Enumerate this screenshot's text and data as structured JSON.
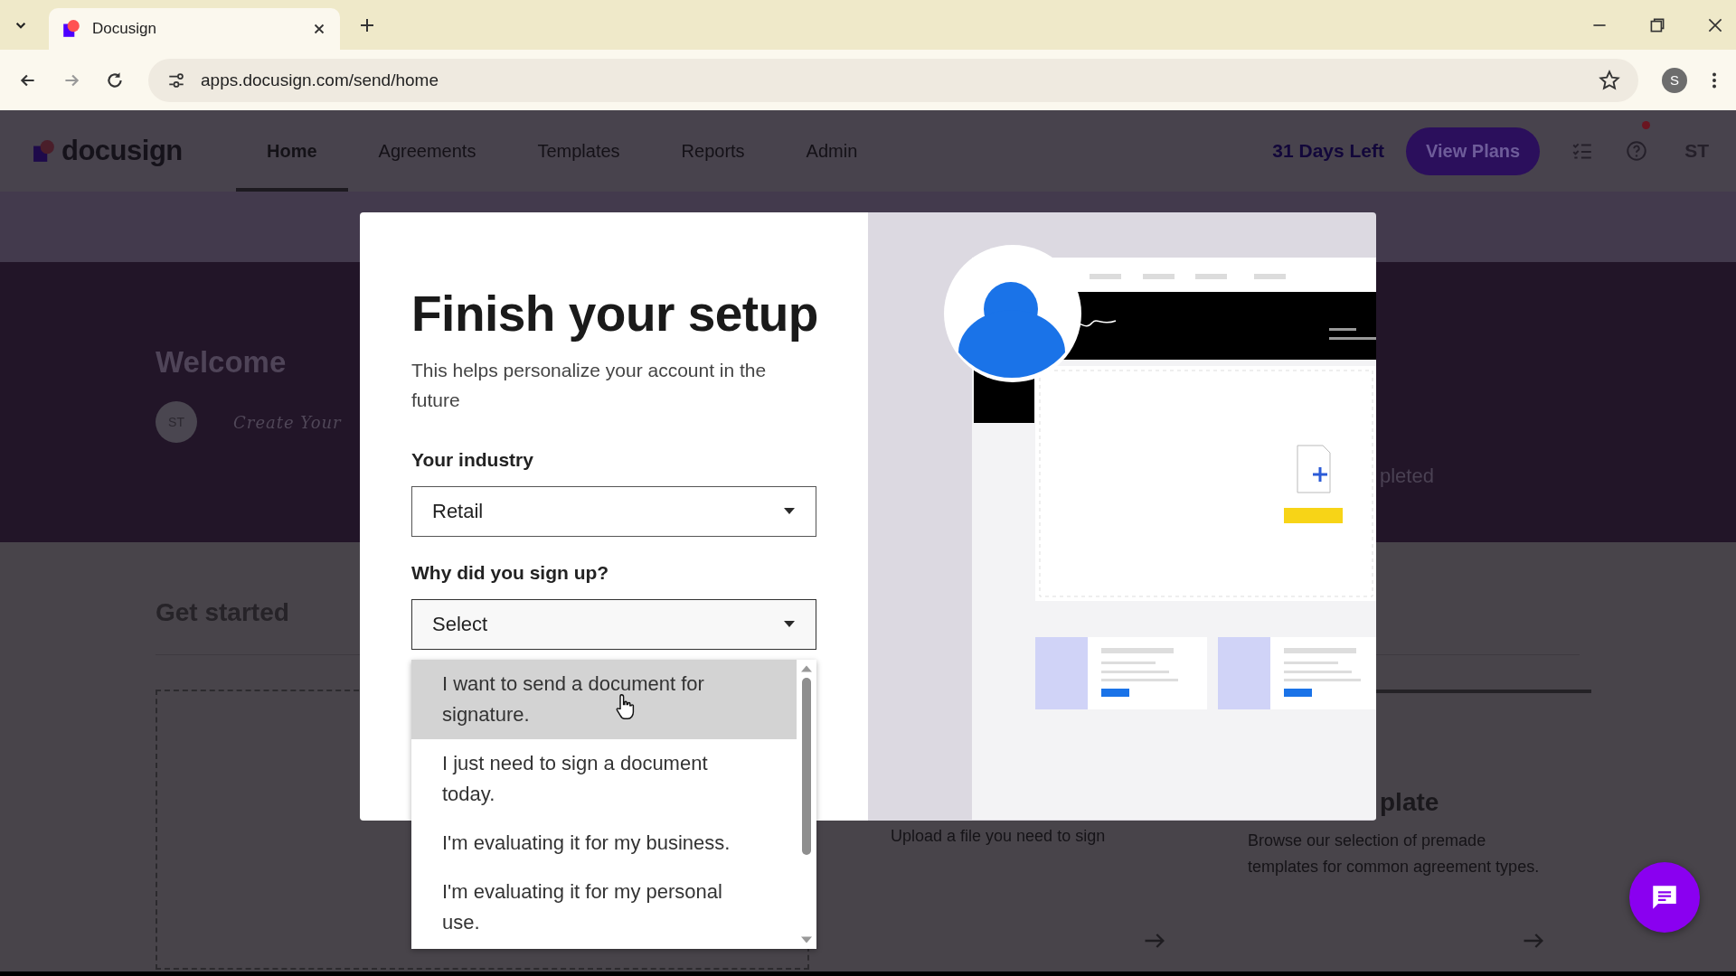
{
  "browser": {
    "tab_title": "Docusign",
    "url": "apps.docusign.com/send/home",
    "profile_initial": "S"
  },
  "app_header": {
    "logo": "docusign",
    "nav": [
      {
        "label": "Home",
        "selected": true
      },
      {
        "label": "Agreements",
        "selected": false
      },
      {
        "label": "Templates",
        "selected": false
      },
      {
        "label": "Reports",
        "selected": false
      },
      {
        "label": "Admin",
        "selected": false
      }
    ],
    "trial": "31 Days Left",
    "plans_button": "View Plans",
    "avatar": "ST"
  },
  "background": {
    "welcome": "Welcome",
    "avatar": "ST",
    "signature": "Create Your",
    "status_fragment": "pleted",
    "section_title": "Get started",
    "cards": [
      {
        "kind": "upload",
        "description": "Upload a file you need to sign"
      },
      {
        "kind": "template",
        "title": "plate",
        "description": "Browse our selection of premade templates for common agreement types."
      }
    ]
  },
  "modal": {
    "title": "Finish your setup",
    "subtitle": "This helps personalize your account in the future",
    "fields": [
      {
        "label": "Your industry",
        "value": "Retail",
        "expanded": false
      },
      {
        "label": "Why did you sign up?",
        "value": "Select",
        "expanded": true
      }
    ],
    "options": [
      {
        "text": "I want to send a document for signature.",
        "highlighted": true
      },
      {
        "text": "I just need to sign a document today.",
        "highlighted": false
      },
      {
        "text": "I'm evaluating it for my business.",
        "highlighted": false
      },
      {
        "text": "I'm evaluating it for my personal use.",
        "highlighted": false
      }
    ]
  }
}
